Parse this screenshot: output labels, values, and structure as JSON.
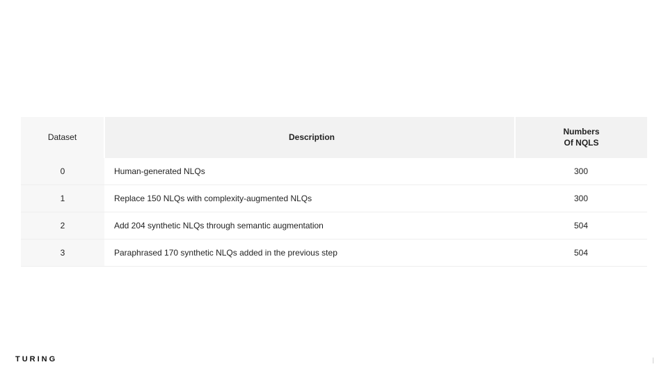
{
  "table": {
    "headers": {
      "dataset": "Dataset",
      "description": "Description",
      "numbers_line1": "Numbers",
      "numbers_line2": "Of NQLS"
    },
    "rows": [
      {
        "dataset": "0",
        "description": "Human-generated NLQs",
        "num": "300"
      },
      {
        "dataset": "1",
        "description": "Replace 150 NLQs with complexity-augmented NLQs",
        "num": "300"
      },
      {
        "dataset": "2",
        "description": "Add 204 synthetic NLQs through semantic augmentation",
        "num": "504"
      },
      {
        "dataset": "3",
        "description": "Paraphrased 170 synthetic NLQs added in the previous step",
        "num": "504"
      }
    ]
  },
  "footer": {
    "logo": "TURING",
    "mark": "|"
  },
  "chart_data": {
    "type": "table",
    "title": "",
    "columns": [
      "Dataset",
      "Description",
      "Numbers Of NQLS"
    ],
    "rows": [
      [
        "0",
        "Human-generated NLQs",
        300
      ],
      [
        "1",
        "Replace 150 NLQs with complexity-augmented NLQs",
        300
      ],
      [
        "2",
        "Add 204 synthetic NLQs through semantic augmentation",
        504
      ],
      [
        "3",
        "Paraphrased 170 synthetic NLQs added in the previous step",
        504
      ]
    ]
  }
}
